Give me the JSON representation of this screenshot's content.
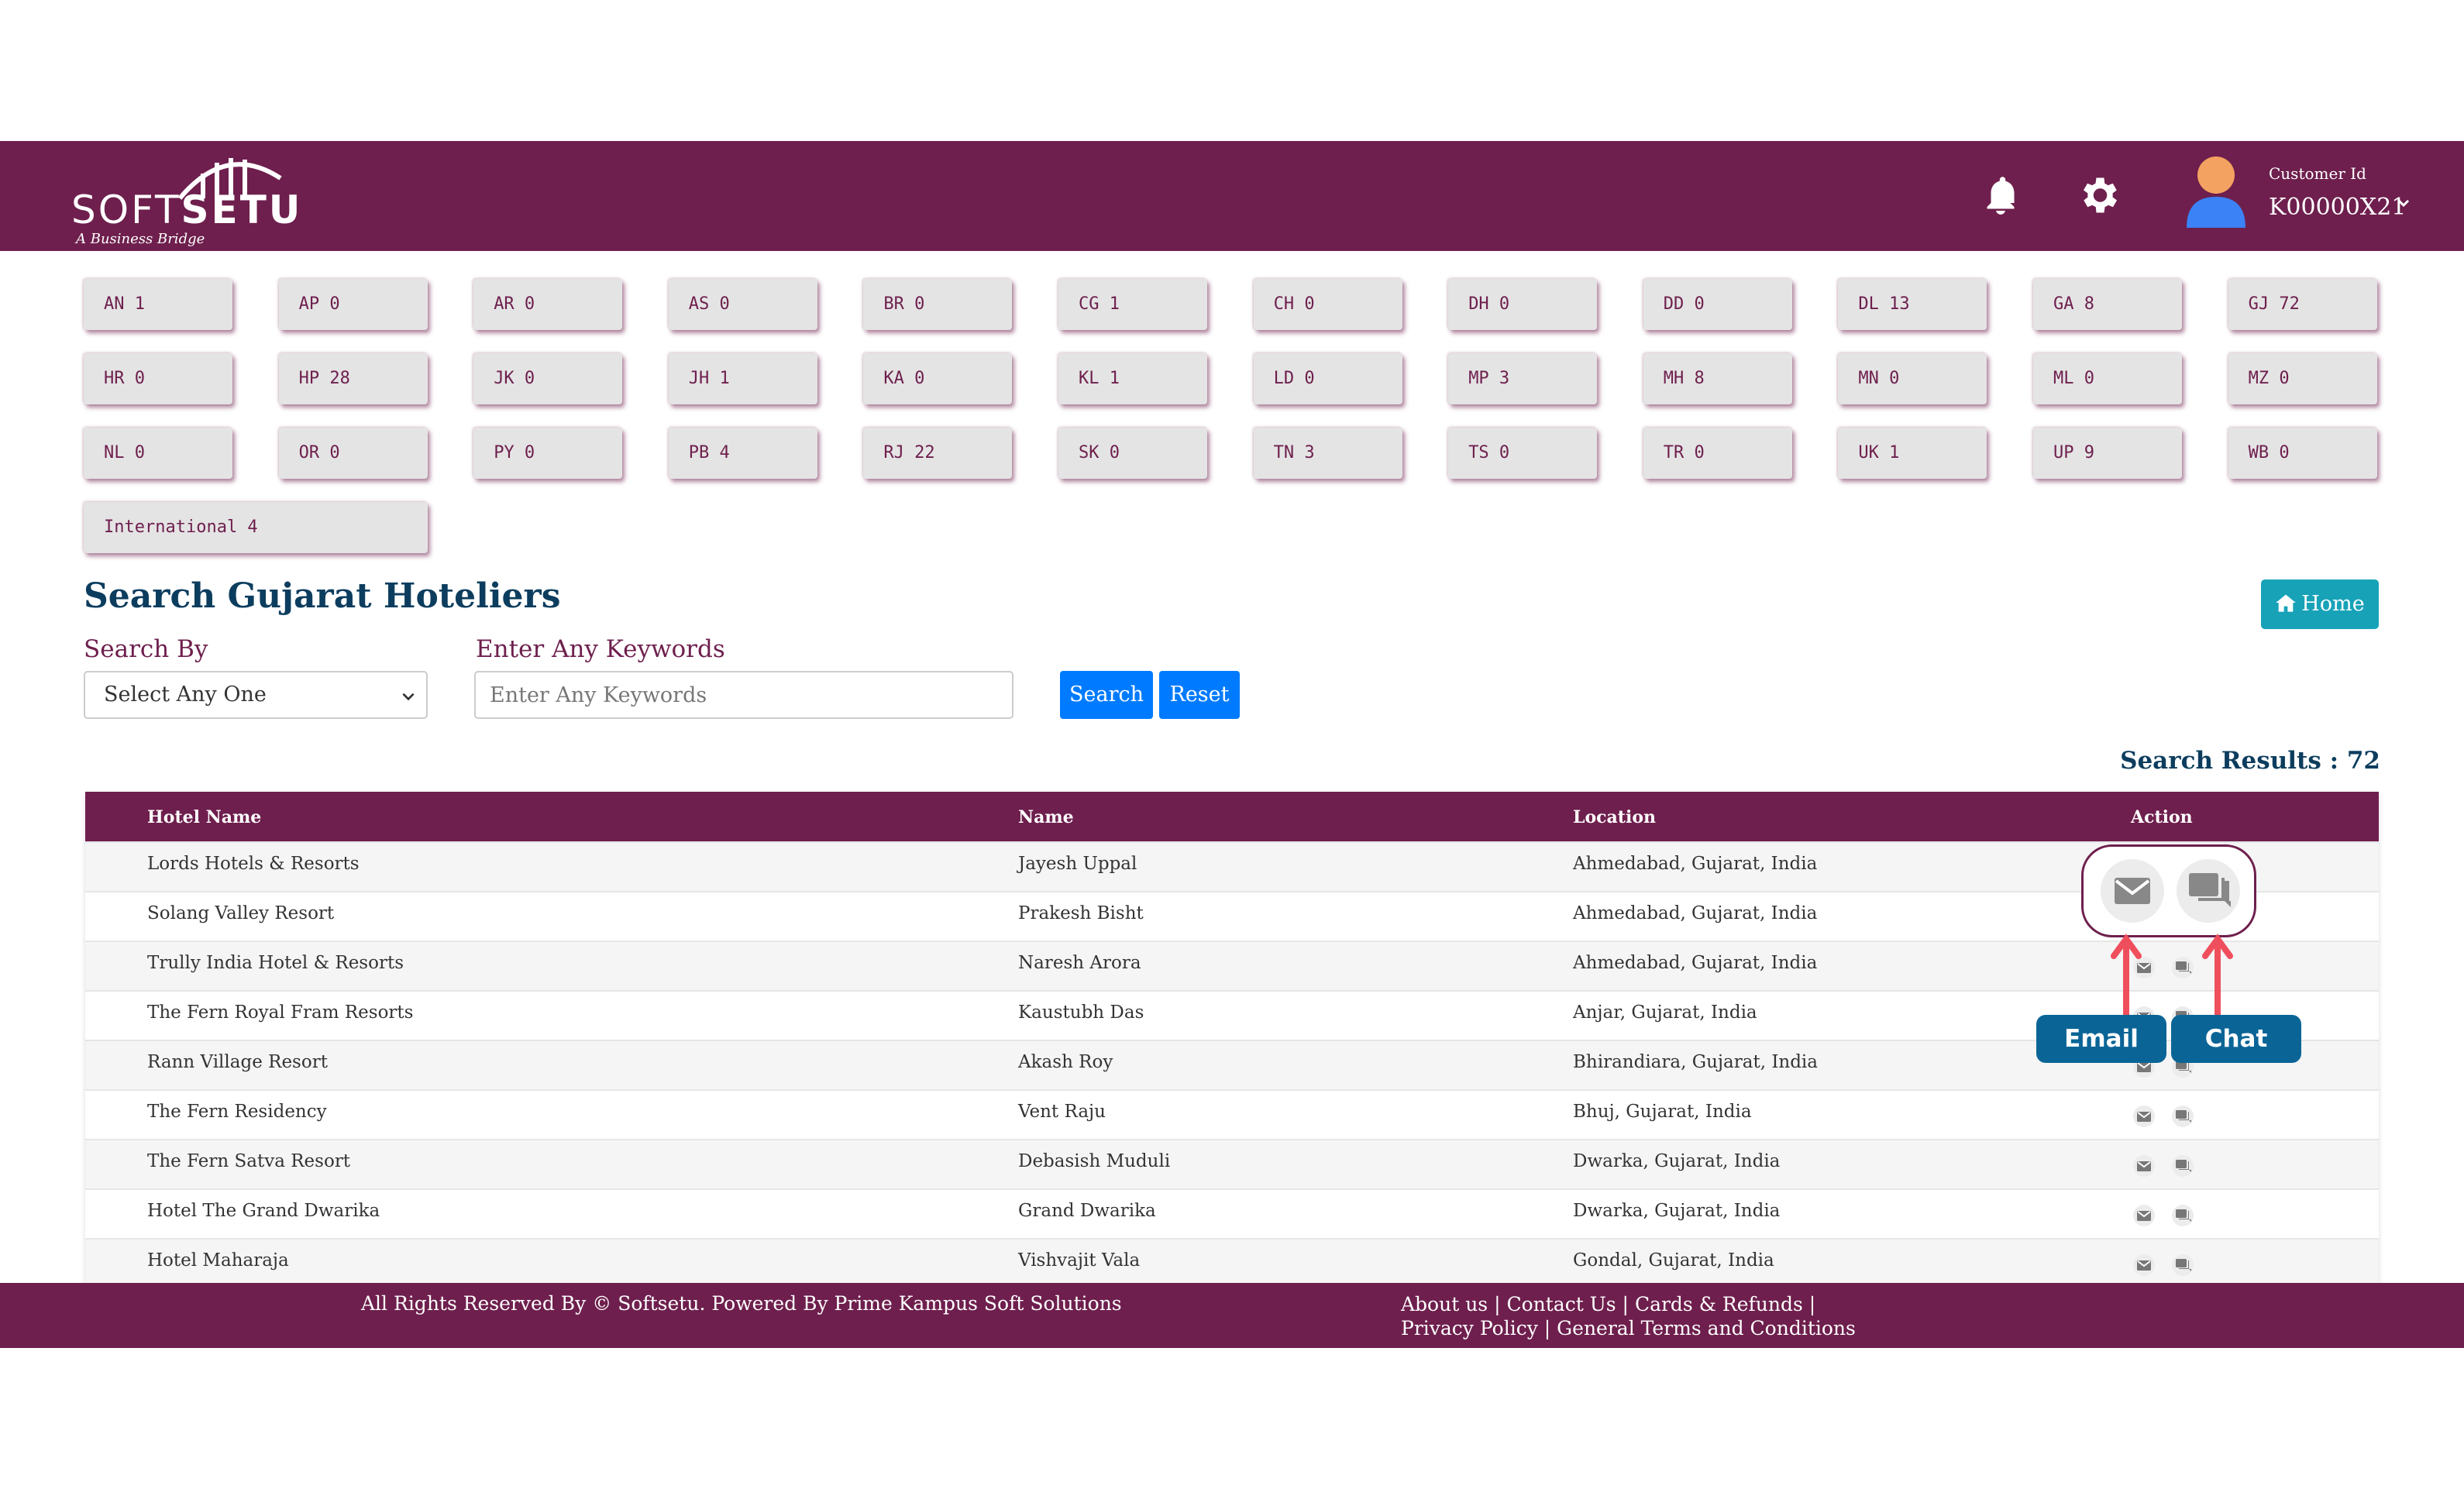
{
  "header": {
    "logo_word_light": "SOFT",
    "logo_word_bold": "SETU",
    "logo_tagline": "A Business Bridge",
    "customer_label": "Customer Id",
    "customer_id": "K00000X21",
    "icons": [
      "bell-icon",
      "gear-icon",
      "user-avatar-icon",
      "chevron-down-icon"
    ],
    "colors": {
      "brand": "#6e1f4d",
      "title": "#0c3d5e",
      "primary": "#007bff",
      "home": "#17a2b8"
    }
  },
  "states": [
    {
      "label": "AN 1"
    },
    {
      "label": "AP 0"
    },
    {
      "label": "AR 0"
    },
    {
      "label": "AS 0"
    },
    {
      "label": "BR 0"
    },
    {
      "label": "CG 1"
    },
    {
      "label": "CH 0"
    },
    {
      "label": "DH 0"
    },
    {
      "label": "DD 0"
    },
    {
      "label": "DL 13"
    },
    {
      "label": "GA 8"
    },
    {
      "label": "GJ 72"
    },
    {
      "label": "HR 0"
    },
    {
      "label": "HP 28"
    },
    {
      "label": "JK 0"
    },
    {
      "label": "JH 1"
    },
    {
      "label": "KA 0"
    },
    {
      "label": "KL 1"
    },
    {
      "label": "LD 0"
    },
    {
      "label": "MP 3"
    },
    {
      "label": "MH 8"
    },
    {
      "label": "MN 0"
    },
    {
      "label": "ML 0"
    },
    {
      "label": "MZ 0"
    },
    {
      "label": "NL 0"
    },
    {
      "label": "OR 0"
    },
    {
      "label": "PY 0"
    },
    {
      "label": "PB 4"
    },
    {
      "label": "RJ 22"
    },
    {
      "label": "SK 0"
    },
    {
      "label": "TN 3"
    },
    {
      "label": "TS 0"
    },
    {
      "label": "TR 0"
    },
    {
      "label": "UK 1"
    },
    {
      "label": "UP 9"
    },
    {
      "label": "WB 0"
    },
    {
      "label": "International 4"
    }
  ],
  "search": {
    "title": "Search Gujarat Hoteliers",
    "home_label": "Home",
    "search_by_label": "Search By",
    "search_by_value": "Select Any One",
    "keywords_label": "Enter Any Keywords",
    "keywords_placeholder": "Enter Any Keywords",
    "search_button": "Search",
    "reset_button": "Reset",
    "results_text": "Search Results : 72"
  },
  "table": {
    "headers": [
      "Hotel Name",
      "Name",
      "Location",
      "Action"
    ],
    "rows": [
      {
        "hotel": "Lords Hotels & Resorts",
        "name": "Jayesh Uppal",
        "location": "Ahmedabad, Gujarat, India"
      },
      {
        "hotel": "Solang Valley Resort",
        "name": "Prakesh Bisht",
        "location": "Ahmedabad, Gujarat, India"
      },
      {
        "hotel": "Trully India Hotel & Resorts",
        "name": "Naresh Arora",
        "location": "Ahmedabad, Gujarat, India"
      },
      {
        "hotel": "The Fern Royal Fram Resorts",
        "name": "Kaustubh Das",
        "location": "Anjar, Gujarat, India"
      },
      {
        "hotel": "Rann Village Resort",
        "name": "Akash Roy",
        "location": "Bhirandiara, Gujarat, India"
      },
      {
        "hotel": "The Fern Residency",
        "name": "Vent Raju",
        "location": "Bhuj, Gujarat, India"
      },
      {
        "hotel": "The Fern Satva Resort",
        "name": "Debasish Muduli",
        "location": "Dwarka, Gujarat, India"
      },
      {
        "hotel": "Hotel The Grand Dwarika",
        "name": "Grand Dwarika",
        "location": "Dwarka, Gujarat, India"
      },
      {
        "hotel": "Hotel Maharaja",
        "name": "Vishvajit Vala",
        "location": "Gondal, Gujarat, India"
      }
    ]
  },
  "annotations": {
    "email_label": "Email",
    "chat_label": "Chat"
  },
  "footer": {
    "copyright": "All Rights Reserved By © Softsetu. Powered By Prime Kampus Soft Solutions",
    "links": [
      "About us",
      "Contact Us",
      "Cards & Refunds",
      "Privacy Policy",
      "General Terms and Conditions"
    ]
  }
}
